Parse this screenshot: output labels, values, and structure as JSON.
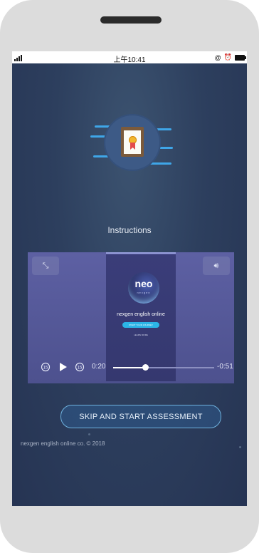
{
  "status_bar": {
    "time": "上午10:41",
    "right_icons": [
      "@",
      "alarm-icon",
      "battery-icon"
    ]
  },
  "page": {
    "title": "Instructions",
    "skip_button": "SKIP AND START ASSESSMENT",
    "footer": "nexgen english online co. © 2018"
  },
  "video": {
    "logo_text": "neo",
    "logo_subtext": "nexgen",
    "brand_title": "nexgen english online",
    "start_button": "START YOUR JOURNEY",
    "learn_more": "LEARN MORE",
    "current_time": "0:20",
    "remaining_time": "-0:51",
    "progress": 0.32,
    "rewind_label": "15",
    "forward_label": "15"
  },
  "colors": {
    "screen_bg": "#2d3f5e",
    "accent": "#3fa6e8",
    "video_bg": "#5d60a3"
  }
}
